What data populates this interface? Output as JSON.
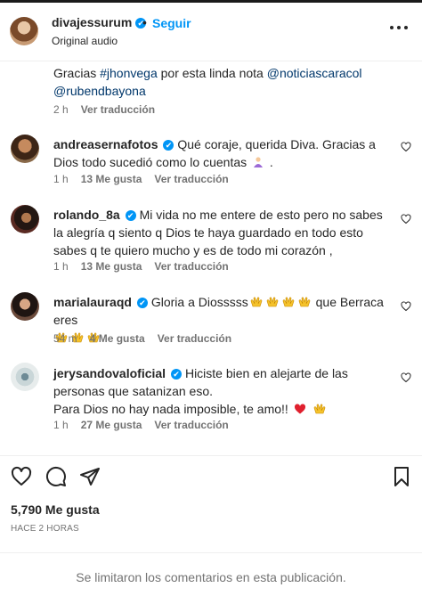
{
  "header": {
    "username": "divajessurum",
    "verified_mark": "✔",
    "separator": "•",
    "follow_label": "Seguir",
    "audio_label": "Original audio",
    "more_icon": "more-horizontal-icon"
  },
  "caption": {
    "prefix": "Gracias ",
    "hashtag": "#jhonvega",
    "middle": " por esta linda nota ",
    "mention1": "@noticiascaracol",
    "mention2": "@rubendbayona",
    "time": "2 h",
    "translate_label": "Ver traducción"
  },
  "comments": [
    {
      "username": "andreasernafotos",
      "text": "Qué coraje, querida Diva. Gracias a Dios todo sucedió como lo cuentas",
      "emoji_tail": " .",
      "time": "1 h",
      "likes": "13 Me gusta",
      "translate_label": "Ver traducción"
    },
    {
      "username": "rolando_8a",
      "text": "Mi vida no me entere de esto pero no sabes la alegría q siento q Dios te haya guardado en todo esto sabes q te quiero mucho y es de todo mi corazón ,",
      "time": "1 h",
      "likes": "13 Me gusta",
      "translate_label": "Ver traducción"
    },
    {
      "username": "marialauraqd",
      "text": "Gloria a Diosssss",
      "text_after": " que Berraca eres",
      "time": "54 m",
      "likes": "4 Me gusta",
      "translate_label": "Ver traducción"
    },
    {
      "username": "jerysandovaloficial",
      "text": "Hiciste bien en alejarte de las personas que satanizan eso.",
      "text_line2": "Para Dios no hay nada imposible, te amo!!",
      "time": "1 h",
      "likes": "27 Me gusta",
      "translate_label": "Ver traducción"
    }
  ],
  "footer": {
    "likes_count": "5,790 Me gusta",
    "time_ago": "HACE 2 HORAS",
    "comments_limited": "Se limitaron los comentarios en esta publicación."
  },
  "colors": {
    "link": "#00376b",
    "follow": "#0095f6",
    "muted": "#737373",
    "verified": "#0095f6"
  }
}
